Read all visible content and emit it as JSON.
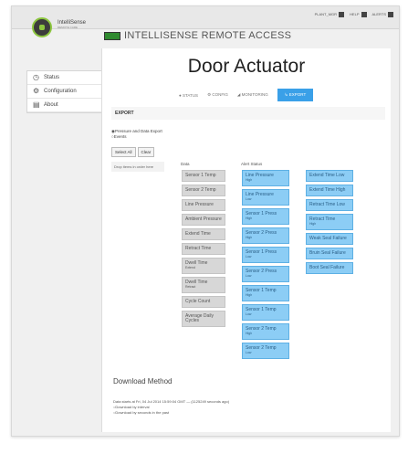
{
  "topbar": {
    "items": [
      {
        "label": "PLANT_MGR",
        "icon": "user-icon"
      },
      {
        "label": "HELP",
        "icon": "help-icon"
      },
      {
        "label": "ALERTS",
        "icon": "bell-icon"
      }
    ]
  },
  "brand": {
    "name": "IntelliSense",
    "sub": "REMOTE CARE"
  },
  "app_title": "INTELLISENSE REMOTE ACCESS",
  "sidebar": {
    "items": [
      {
        "label": "Status",
        "icon": "clock-icon"
      },
      {
        "label": "Configuration",
        "icon": "gear-icon"
      },
      {
        "label": "About",
        "icon": "book-icon"
      }
    ]
  },
  "device_title": "Door Actuator",
  "tabs": [
    {
      "label": "STATUS",
      "active": false
    },
    {
      "label": "CONFIG",
      "active": false
    },
    {
      "label": "MONITORING",
      "active": false
    },
    {
      "label": "EXPORT",
      "active": true
    }
  ],
  "export": {
    "header": "EXPORT",
    "radio_options": [
      "Pressure and Data Export",
      "Events"
    ],
    "buttons": {
      "select_all": "Select All",
      "clear": "Clear"
    },
    "drop_label": "Drop items in order here",
    "data_title": "Data",
    "alert_title": "Alert Status",
    "data_items": [
      {
        "label": "Sensor 1 Temp",
        "sub": ""
      },
      {
        "label": "Sensor 2 Temp",
        "sub": ""
      },
      {
        "label": "Line Pressure",
        "sub": ""
      },
      {
        "label": "Ambient Pressure",
        "sub": ""
      },
      {
        "label": "Extend Time",
        "sub": ""
      },
      {
        "label": "Retract Time",
        "sub": ""
      },
      {
        "label": "Dwell Time",
        "sub": "Extend"
      },
      {
        "label": "Dwell Time",
        "sub": "Retract"
      },
      {
        "label": "Cycle Count",
        "sub": ""
      },
      {
        "label": "Average Daily Cycles",
        "sub": ""
      }
    ],
    "alert_items_col1": [
      {
        "label": "Line Pressure",
        "sub": "High"
      },
      {
        "label": "Line Pressure",
        "sub": "Low"
      },
      {
        "label": "Sensor 1 Press",
        "sub": "High"
      },
      {
        "label": "Sensor 2 Press",
        "sub": "High"
      },
      {
        "label": "Sensor 1 Press",
        "sub": "Low"
      },
      {
        "label": "Sensor 2 Press",
        "sub": "Low"
      },
      {
        "label": "Sensor 1 Temp",
        "sub": "High"
      },
      {
        "label": "Sensor 1 Temp",
        "sub": "Low"
      },
      {
        "label": "Sensor 2 Temp",
        "sub": "High"
      },
      {
        "label": "Sensor 2 Temp",
        "sub": "Low"
      }
    ],
    "alert_items_col2": [
      {
        "label": "Extend Time Low",
        "sub": ""
      },
      {
        "label": "Extend Time High",
        "sub": ""
      },
      {
        "label": "Retract Time Low",
        "sub": ""
      },
      {
        "label": "Retract Time",
        "sub": "High"
      },
      {
        "label": "Weak Seal Failure",
        "sub": ""
      },
      {
        "label": "Bruin Seal Failure",
        "sub": ""
      },
      {
        "label": "Boot Seal Failure",
        "sub": ""
      }
    ]
  },
  "download": {
    "title": "Download Method",
    "info": "Data starts at Fri, 04 Jul 2014 15:59:04 GMT — (1125249 seconds ago)",
    "options": [
      "Download by interval",
      "Download by seconds in the past"
    ]
  },
  "colors": {
    "accent": "#3aa0e8",
    "chip_blue": "#8ccdf5",
    "chip_gray": "#d7d7d7",
    "logo_green": "#8cc63f"
  }
}
